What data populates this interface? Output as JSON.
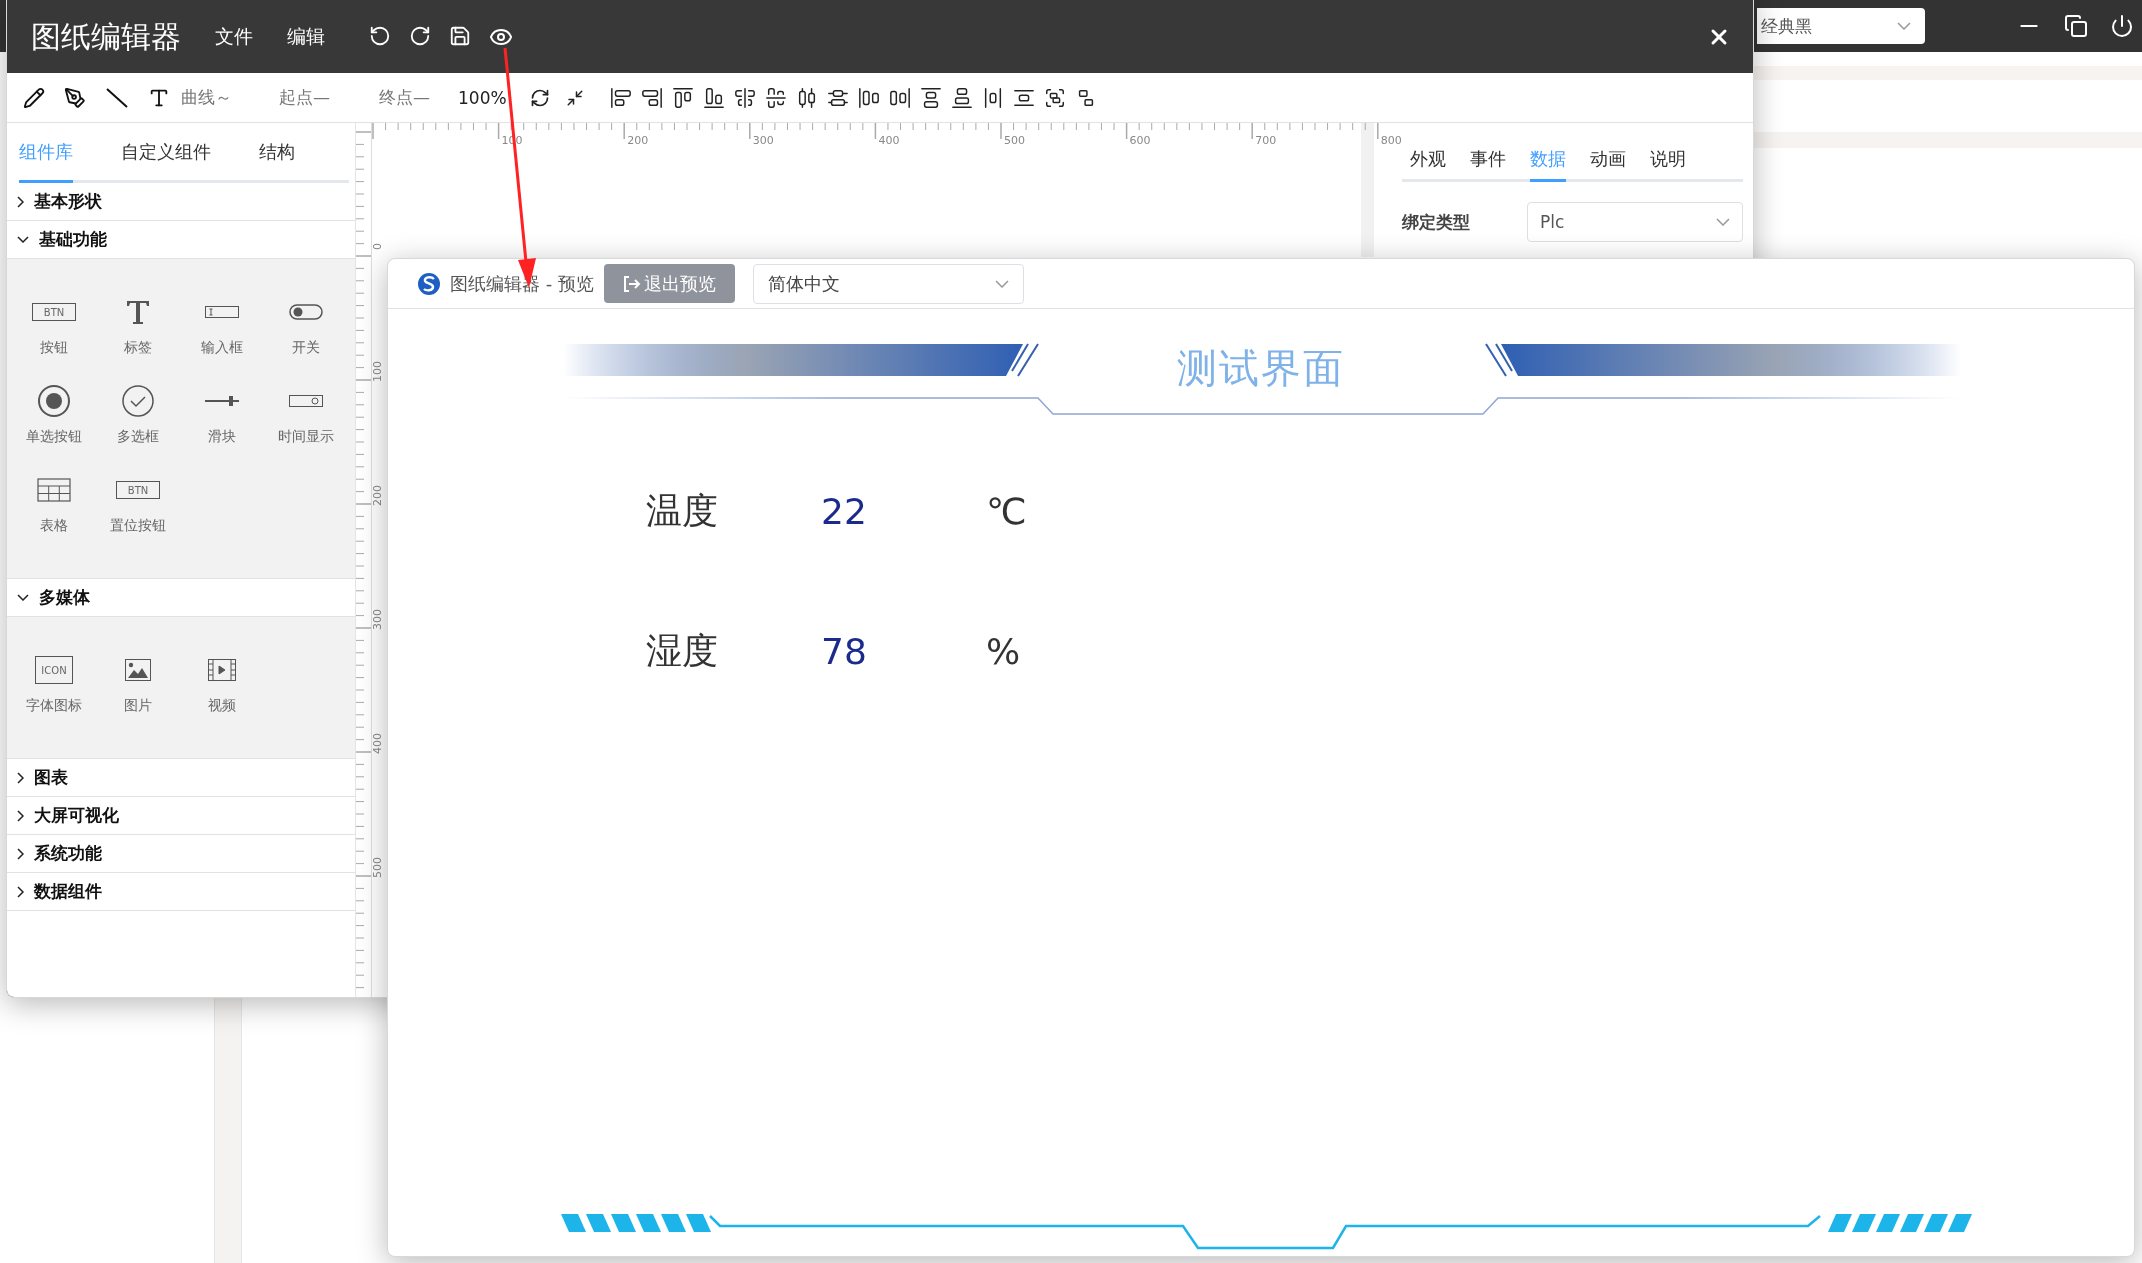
{
  "background": {
    "theme_select": "经典黑"
  },
  "editor": {
    "title": "图纸编辑器",
    "menu": [
      "文件",
      "编辑"
    ],
    "toolbar": {
      "curve": "曲线～",
      "start_point": "起点—",
      "end_point": "终点—",
      "zoom": "100%"
    },
    "left_tabs": [
      {
        "label": "组件库",
        "selected": true
      },
      {
        "label": "自定义组件",
        "selected": false
      },
      {
        "label": "结构",
        "selected": false
      }
    ],
    "sections": [
      {
        "title": "基本形状",
        "expanded": false
      },
      {
        "title": "基础功能",
        "expanded": true,
        "items": [
          {
            "label": "按钮",
            "kind": "button",
            "icon_text": "BTN"
          },
          {
            "label": "标签",
            "kind": "text"
          },
          {
            "label": "输入框",
            "kind": "input"
          },
          {
            "label": "开关",
            "kind": "switch"
          },
          {
            "label": "单选按钮",
            "kind": "radio"
          },
          {
            "label": "多选框",
            "kind": "checkbox"
          },
          {
            "label": "滑块",
            "kind": "slider"
          },
          {
            "label": "时间显示",
            "kind": "clock"
          },
          {
            "label": "表格",
            "kind": "table"
          },
          {
            "label": "置位按钮",
            "kind": "button",
            "icon_text": "BTN"
          }
        ]
      },
      {
        "title": "多媒体",
        "expanded": true,
        "items": [
          {
            "label": "字体图标",
            "kind": "font-icon",
            "icon_text": "ICON"
          },
          {
            "label": "图片",
            "kind": "image"
          },
          {
            "label": "视频",
            "kind": "video"
          }
        ]
      },
      {
        "title": "图表",
        "expanded": false
      },
      {
        "title": "大屏可视化",
        "expanded": false
      },
      {
        "title": "系统功能",
        "expanded": false
      },
      {
        "title": "数据组件",
        "expanded": false
      }
    ],
    "ruler": {
      "x_labels": [
        "100",
        "200",
        "300",
        "400",
        "500",
        "600",
        "700",
        "800"
      ],
      "y_labels": [
        "0",
        "100",
        "200",
        "300",
        "400",
        "500"
      ]
    },
    "right_panel": {
      "tabs": [
        {
          "label": "外观",
          "selected": false
        },
        {
          "label": "事件",
          "selected": false
        },
        {
          "label": "数据",
          "selected": true
        },
        {
          "label": "动画",
          "selected": false
        },
        {
          "label": "说明",
          "selected": false
        }
      ],
      "binding_label": "绑定类型",
      "binding_value": "Plc"
    }
  },
  "preview": {
    "title": "图纸编辑器 - 预览",
    "exit_button": "退出预览",
    "language": "简体中文",
    "heading": "测试界面",
    "rows": [
      {
        "label": "温度",
        "value": "22",
        "unit": "℃"
      },
      {
        "label": "湿度",
        "value": "78",
        "unit": "%"
      }
    ]
  }
}
